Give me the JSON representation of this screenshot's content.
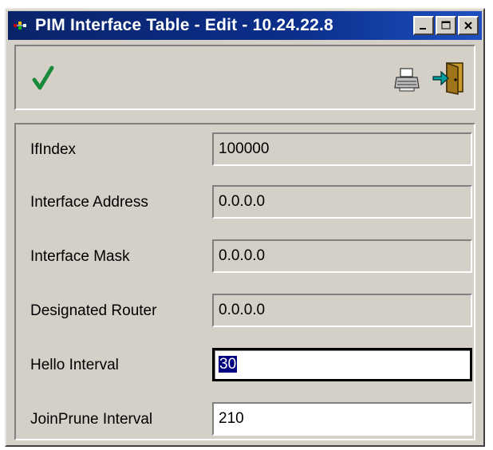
{
  "window": {
    "title": "PIM Interface Table - Edit - 10.24.22.8",
    "icons": {
      "app": "pim-app-icon",
      "minimize": "minimize-icon",
      "maximize": "maximize-icon",
      "close": "close-icon"
    }
  },
  "toolbar": {
    "ok_icon": "checkmark-icon",
    "print_icon": "printer-icon",
    "exit_icon": "exit-door-icon",
    "colors": {
      "check": "#1a8a3a",
      "exit_accent": "#00a0a0"
    }
  },
  "form": {
    "fields": [
      {
        "label": "IfIndex",
        "value": "100000",
        "editable": false
      },
      {
        "label": "Interface Address",
        "value": "0.0.0.0",
        "editable": false
      },
      {
        "label": "Interface Mask",
        "value": "0.0.0.0",
        "editable": false
      },
      {
        "label": "Designated Router",
        "value": "0.0.0.0",
        "editable": false
      },
      {
        "label": "Hello Interval",
        "value": "30",
        "editable": true,
        "focused": true,
        "selected": true
      },
      {
        "label": "JoinPrune Interval",
        "value": "210",
        "editable": true
      }
    ]
  }
}
